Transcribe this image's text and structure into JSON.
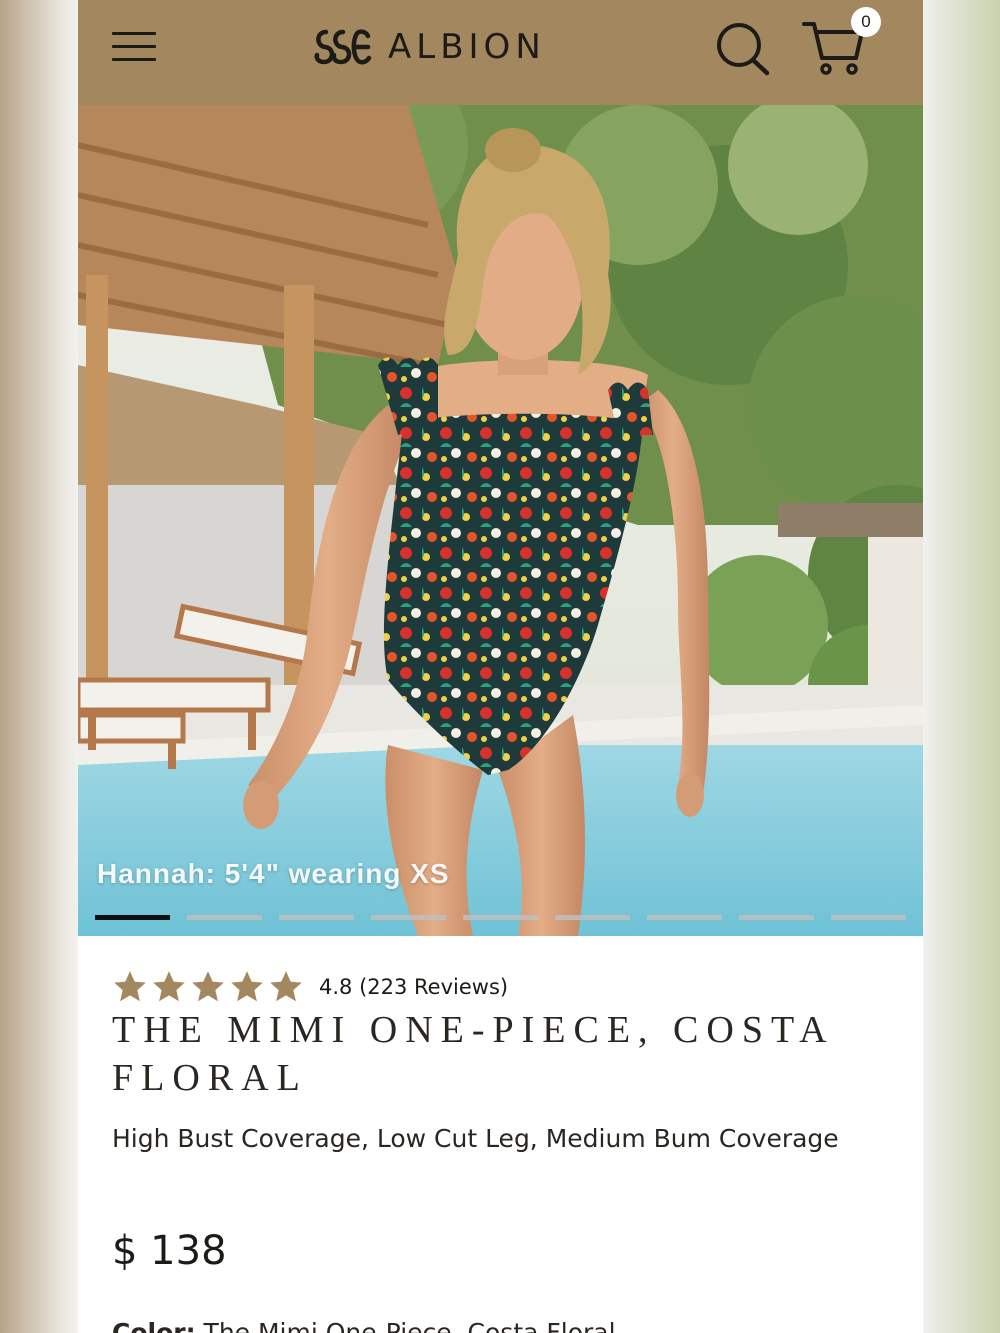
{
  "header": {
    "brand": "ALBION",
    "menu_icon": "hamburger-menu-icon",
    "search_icon": "search-icon",
    "cart_icon": "cart-icon",
    "cart_count": "0",
    "background": "#a3875f"
  },
  "gallery": {
    "caption": "Hannah: 5'4\" wearing XS",
    "slide_count": 9,
    "active_slide": 1
  },
  "product": {
    "rating_value": 4.8,
    "rating_text": "4.8 (223 Reviews)",
    "star_color": "#a3875f",
    "title": "THE MIMI ONE-PIECE, COSTA FLORAL",
    "coverage": "High Bust Coverage, Low Cut Leg, Medium Bum Coverage",
    "price": "$ 138",
    "color_label": "Color:",
    "color_value": "The Mimi One-Piece, Costa Floral"
  }
}
